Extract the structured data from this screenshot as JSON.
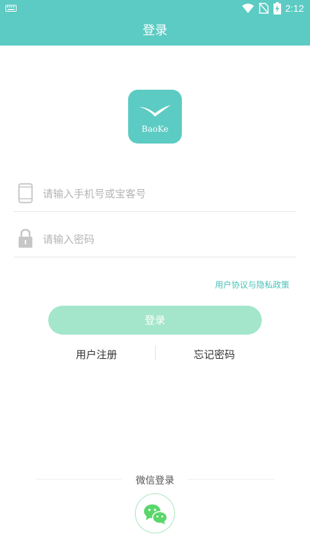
{
  "status_bar": {
    "time": "2:12",
    "icons": [
      "keyboard-icon",
      "wifi-icon",
      "no-sim-icon",
      "battery-charging-icon"
    ]
  },
  "header": {
    "title": "登录"
  },
  "logo": {
    "text": "BaoKe",
    "icon": "bird-icon"
  },
  "form": {
    "phone_placeholder": "请输入手机号或宝客号",
    "phone_value": "",
    "password_placeholder": "请输入密码",
    "password_value": ""
  },
  "policy_link": "用户协议与隐私政策",
  "login_button": "登录",
  "links": {
    "register": "用户注册",
    "forgot": "忘记密码"
  },
  "wechat": {
    "label": "微信登录",
    "icon": "wechat-icon"
  },
  "colors": {
    "primary": "#5ccbc3",
    "button": "#a3e6cc",
    "link": "#48c2b8",
    "wechat_green": "#5ad66b"
  }
}
